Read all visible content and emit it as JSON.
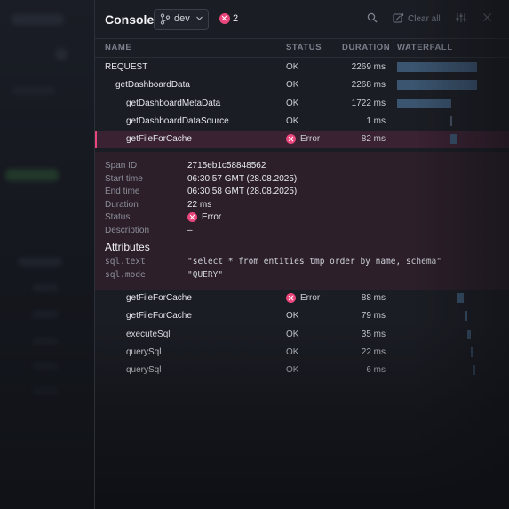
{
  "header": {
    "title": "Console",
    "branch": "dev",
    "error_count": "2",
    "clear_label": "Clear all"
  },
  "columns": {
    "name": "NAME",
    "status": "STATUS",
    "duration": "DURATION",
    "waterfall": "WATERFALL"
  },
  "rows_top": [
    {
      "name": "REQUEST",
      "status": "OK",
      "duration": "2269 ms",
      "indent": 0,
      "wf_start": 0.0,
      "wf_len": 1.0
    },
    {
      "name": "getDashboardData",
      "status": "OK",
      "duration": "2268 ms",
      "indent": 1,
      "wf_start": 0.0,
      "wf_len": 1.0
    },
    {
      "name": "getDashboardMetaData",
      "status": "OK",
      "duration": "1722 ms",
      "indent": 2,
      "wf_start": 0.0,
      "wf_len": 0.68
    },
    {
      "name": "getDashboardDataSource",
      "status": "OK",
      "duration": "1 ms",
      "indent": 2,
      "wf_start": 0.67,
      "wf_len": 0.0
    },
    {
      "name": "getFileForCache",
      "status": "Error",
      "duration": "82 ms",
      "indent": 2,
      "wf_start": 0.67,
      "wf_len": 0.08,
      "selected": true
    }
  ],
  "detail": {
    "fields": [
      {
        "key": "Span ID",
        "value": "2715eb1c58848562"
      },
      {
        "key": "Start time",
        "value": "06:30:57 GMT (28.08.2025)"
      },
      {
        "key": "End time",
        "value": "06:30:58 GMT (28.08.2025)"
      },
      {
        "key": "Duration",
        "value": "22 ms"
      },
      {
        "key": "Status",
        "value": "Error"
      },
      {
        "key": "Description",
        "value": "–"
      }
    ],
    "attributes_title": "Attributes",
    "attributes": [
      {
        "key": "sql.text",
        "value": "\"select * from entities_tmp order by name, schema\""
      },
      {
        "key": "sql.mode",
        "value": "\"QUERY\""
      }
    ]
  },
  "rows_bottom": [
    {
      "name": "getFileForCache",
      "status": "Error",
      "duration": "88 ms",
      "indent": 2,
      "wf_start": 0.75,
      "wf_len": 0.08
    },
    {
      "name": "getFileForCache",
      "status": "OK",
      "duration": "79 ms",
      "indent": 2,
      "wf_start": 0.84,
      "wf_len": 0.04
    },
    {
      "name": "executeSql",
      "status": "OK",
      "duration": "35 ms",
      "indent": 2,
      "wf_start": 0.88,
      "wf_len": 0.04
    },
    {
      "name": "querySql",
      "status": "OK",
      "duration": "22 ms",
      "indent": 2,
      "wf_start": 0.92,
      "wf_len": 0.04
    },
    {
      "name": "querySql",
      "status": "OK",
      "duration": "6 ms",
      "indent": 2,
      "wf_start": 0.96,
      "wf_len": 0.02
    }
  ],
  "colors": {
    "accent_error": "#e9467c",
    "waterfall_bar": "#3b5570",
    "selected_row": "#3b2232"
  }
}
